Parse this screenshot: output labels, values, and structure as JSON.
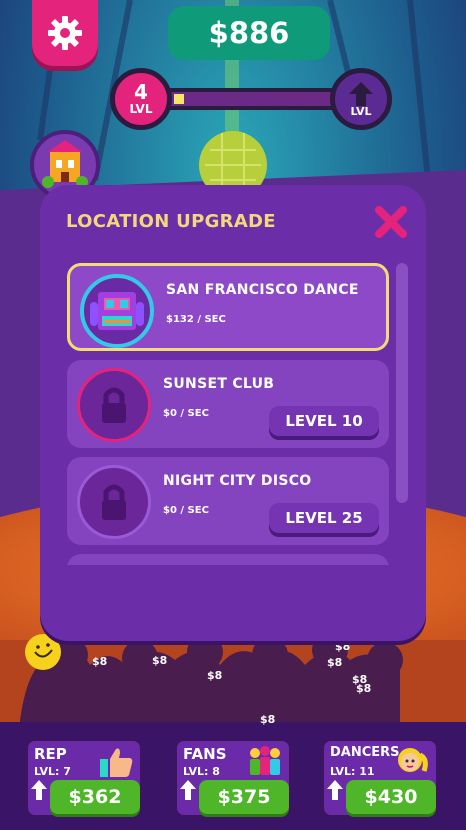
{
  "hud": {
    "money": "$886",
    "level_number": "4",
    "level_label": "LVL",
    "level_progress": 0.06,
    "level_up_label": "LVL"
  },
  "modal": {
    "title": "LOCATION UPGRADE",
    "locations": [
      {
        "name": "SAN FRANCISCO DANCE",
        "rate": "$132 / SEC",
        "locked": false,
        "level_label": ""
      },
      {
        "name": "SUNSET CLUB",
        "rate": "$0 / SEC",
        "locked": true,
        "level_label": "LEVEL 10"
      },
      {
        "name": "NIGHT CITY DISCO",
        "rate": "$0 / SEC",
        "locked": true,
        "level_label": "LEVEL 25"
      }
    ]
  },
  "floor_earnings": [
    "$8",
    "$8",
    "$8",
    "$8",
    "$8",
    "$8",
    "$8",
    "$8"
  ],
  "stats": [
    {
      "title": "REP",
      "level": "LVL: 7",
      "price": "$362",
      "icon": "thumbs-up-icon"
    },
    {
      "title": "FANS",
      "level": "LVL: 8",
      "price": "$375",
      "icon": "fans-icon"
    },
    {
      "title": "DANCERS",
      "level": "LVL: 11",
      "price": "$430",
      "icon": "dancer-icon"
    }
  ],
  "colors": {
    "accent_pink": "#e3237c",
    "money_green": "#0f9a79",
    "modal_purple": "#6b2ea8",
    "title_gold": "#f4d77a",
    "buy_green": "#4fb62a"
  }
}
